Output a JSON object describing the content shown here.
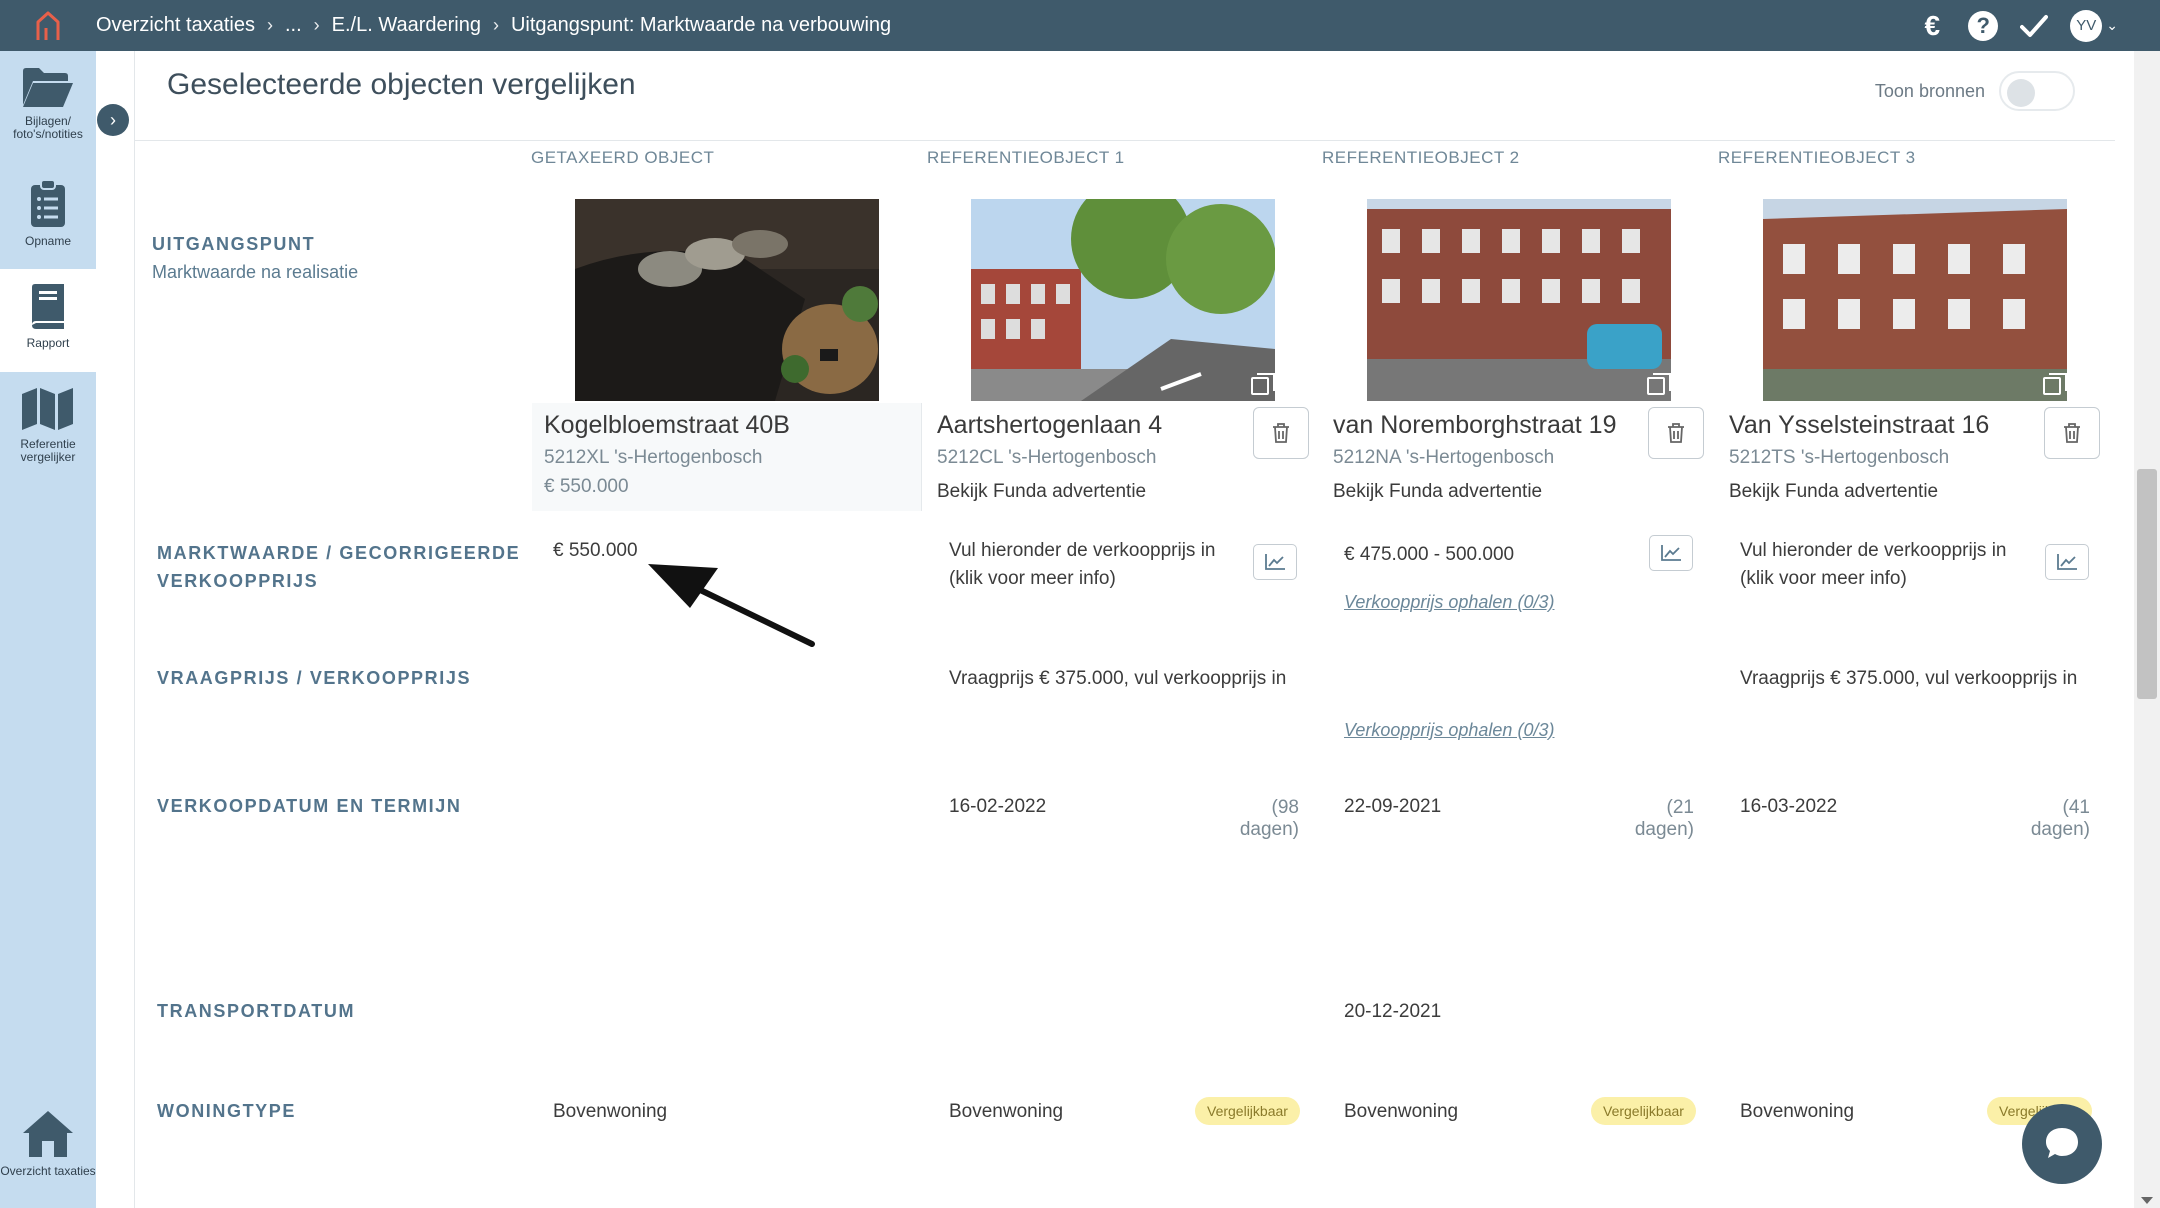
{
  "topbar": {
    "breadcrumbs": [
      "Overzicht taxaties",
      "...",
      "E./L. Waardering",
      "Uitgangspunt: Marktwaarde na verbouwing"
    ],
    "icons": [
      "home-logo",
      "euro-icon",
      "help-icon",
      "check-icon",
      "avatar"
    ],
    "avatar_initials": "YV"
  },
  "sidebar": {
    "items": [
      {
        "label": "Bijlagen/ foto's/notities",
        "icon": "folder-icon"
      },
      {
        "label": "Opname",
        "icon": "clipboard-icon"
      },
      {
        "label": "Rapport",
        "icon": "book-icon"
      },
      {
        "label": "Referentie vergelijker",
        "icon": "map-icon"
      },
      {
        "label": "Overzicht taxaties",
        "icon": "home-icon"
      }
    ]
  },
  "header": {
    "title": "Geselecteerde objecten vergelijken",
    "toggle_label": "Toon bronnen"
  },
  "columns": [
    {
      "heading": "GETAXEERD OBJECT",
      "address": "Kogelbloemstraat 40B",
      "postal": "5212XL  's-Hertogenbosch",
      "value": "€ 550.000",
      "marktwaarde": "€ 550.000",
      "woningtype": "Bovenwoning"
    },
    {
      "heading": "REFERENTIEOBJECT 1",
      "address": "Aartshertogenlaan 4",
      "postal": "5212CL  's-Hertogenbosch",
      "funda": "Bekijk Funda advertentie",
      "marktwaarde": "Vul hieronder de verkoopprijs in (klik voor meer info)",
      "vraagprijs": "Vraagprijs € 375.000, vul verkoopprijs in",
      "verkoopdatum": "16-02-2022",
      "termijn": "(98 dagen)",
      "woningtype": "Bovenwoning",
      "badge": "Vergelijkbaar"
    },
    {
      "heading": "REFERENTIEOBJECT 2",
      "address": "van Noremborghstraat 19",
      "postal": "5212NA  's-Hertogenbosch",
      "funda": "Bekijk Funda advertentie",
      "marktwaarde": "€ 475.000 - 500.000",
      "ophalen1": "Verkoopprijs ophalen (0/3)",
      "ophalen2": "Verkoopprijs ophalen (0/3)",
      "verkoopdatum": "22-09-2021",
      "termijn": "(21 dagen)",
      "transportdatum": "20-12-2021",
      "woningtype": "Bovenwoning",
      "badge": "Vergelijkbaar"
    },
    {
      "heading": "REFERENTIEOBJECT 3",
      "address": "Van Ysselsteinstraat 16",
      "postal": "5212TS  's-Hertogenbosch",
      "funda": "Bekijk Funda advertentie",
      "marktwaarde": "Vul hieronder de verkoopprijs in (klik voor meer info)",
      "vraagprijs": "Vraagprijs € 375.000, vul verkoopprijs in",
      "verkoopdatum": "16-03-2022",
      "termijn": "(41 dagen)",
      "woningtype": "Bovenwoning",
      "badge": "Vergelijkbaar"
    }
  ],
  "rows": {
    "uitgangspunt": "UITGANGSPUNT",
    "uitgangspunt_sub": "Marktwaarde na realisatie",
    "marktwaarde_line1": "MARKTWAARDE / GECORRIGEERDE",
    "marktwaarde_line2": "VERKOOPPRIJS",
    "vraagprijs": "VRAAGPRIJS / VERKOOPPRIJS",
    "verkoopdatum": "VERKOOPDATUM EN TERMIJN",
    "transportdatum": "TRANSPORTDATUM",
    "woningtype": "WONINGTYPE"
  }
}
